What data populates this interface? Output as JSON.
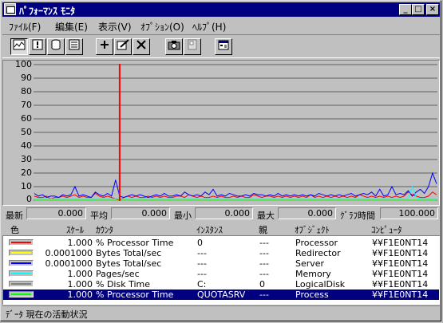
{
  "window": {
    "title": "ﾊﾟﾌｫｰﾏﾝｽ ﾓﾆﾀ"
  },
  "menu": [
    "ﾌｧｲﾙ(F)",
    "編集(E)",
    "表示(V)",
    "ｵﾌﾟｼｮﾝ(O)",
    "ﾍﾙﾌﾟ(H)"
  ],
  "toolbar": {
    "icons": [
      "chart-view-icon",
      "alert-view-icon",
      "log-view-icon",
      "report-view-icon",
      "add-counter-icon",
      "edit-counter-icon",
      "delete-counter-icon",
      "snapshot-icon",
      "bookmark-icon",
      "options-icon"
    ]
  },
  "chart_data": {
    "type": "line",
    "ylim": [
      0,
      100
    ],
    "y_ticks": [
      "100",
      "90",
      "80",
      "70",
      "60",
      "50",
      "40",
      "30",
      "20",
      "10",
      "0"
    ],
    "samples": 100,
    "time_marker_index": 21,
    "grid": "horizontal",
    "series": [
      {
        "color": "#ff0000",
        "values": [
          3,
          2,
          2,
          3,
          1,
          2,
          2,
          3,
          2,
          3,
          4,
          2,
          3,
          2,
          2,
          5,
          3,
          2,
          3,
          2,
          1,
          0,
          2,
          3,
          2,
          3,
          2,
          2,
          3,
          2,
          3,
          2,
          3,
          2,
          2,
          3,
          3,
          2,
          4,
          3,
          2,
          3,
          2,
          2,
          3,
          2,
          3,
          2,
          2,
          3,
          2,
          3,
          2,
          2,
          4,
          3,
          2,
          3,
          3,
          2,
          3,
          2,
          3,
          2,
          3,
          2,
          3,
          2,
          4,
          2,
          3,
          2,
          3,
          2,
          3,
          2,
          3,
          2,
          3,
          2,
          4,
          3,
          2,
          3,
          2,
          3,
          2,
          3,
          2,
          3,
          2,
          3,
          6,
          4,
          3,
          2,
          2,
          3,
          6,
          4
        ]
      },
      {
        "color": "#0000ff",
        "values": [
          5,
          3,
          4,
          2,
          3,
          3,
          2,
          4,
          3,
          4,
          10,
          3,
          4,
          3,
          2,
          6,
          4,
          3,
          5,
          3,
          15,
          3,
          2,
          3,
          4,
          3,
          4,
          3,
          2,
          3,
          4,
          3,
          5,
          3,
          3,
          4,
          3,
          6,
          4,
          3,
          4,
          3,
          6,
          4,
          8,
          3,
          4,
          3,
          5,
          4,
          3,
          3,
          4,
          3,
          5,
          4,
          4,
          3,
          4,
          3,
          5,
          3,
          4,
          3,
          4,
          3,
          4,
          3,
          4,
          3,
          5,
          4,
          3,
          4,
          3,
          4,
          3,
          4,
          5,
          3,
          4,
          5,
          4,
          6,
          3,
          8,
          3,
          4,
          10,
          4,
          5,
          4,
          7,
          3,
          6,
          8,
          5,
          10,
          20,
          12
        ]
      },
      {
        "color": "#00ffff",
        "values": [
          1,
          1,
          1,
          1,
          1,
          1,
          1,
          1,
          1,
          1,
          1,
          1,
          1,
          1,
          1,
          1,
          1,
          1,
          1,
          1,
          1,
          1,
          1,
          1,
          1,
          1,
          1,
          1,
          1,
          1,
          1,
          1,
          1,
          1,
          1,
          1,
          1,
          1,
          1,
          1,
          1,
          1,
          1,
          1,
          1,
          1,
          1,
          1,
          1,
          1,
          1,
          1,
          1,
          1,
          1,
          1,
          1,
          1,
          1,
          1,
          1,
          1,
          1,
          1,
          1,
          1,
          1,
          1,
          1,
          1,
          1,
          1,
          1,
          1,
          1,
          1,
          1,
          1,
          1,
          1,
          1,
          1,
          1,
          1,
          1,
          1,
          1,
          1,
          1,
          1,
          1,
          1,
          1,
          10,
          2,
          1,
          1,
          1,
          1,
          1
        ]
      },
      {
        "color": "#00ff00",
        "values": [
          0,
          0,
          0,
          0,
          0,
          0,
          0,
          0,
          0,
          0,
          0,
          0,
          0,
          0,
          0,
          0,
          0,
          0,
          0,
          0,
          0,
          0,
          0,
          0,
          0,
          0,
          0,
          0,
          0,
          0,
          0,
          0,
          0,
          0,
          0,
          0,
          0,
          0,
          0,
          0,
          0,
          0,
          0,
          0,
          0,
          0,
          0,
          0,
          0,
          0,
          0,
          0,
          0,
          0,
          0,
          0,
          0,
          0,
          0,
          0,
          0,
          0,
          0,
          0,
          0,
          0,
          0,
          0,
          0,
          0,
          0,
          0,
          0,
          0,
          0,
          0,
          0,
          0,
          0,
          0,
          0,
          0,
          0,
          0,
          0,
          0,
          0,
          0,
          0,
          0,
          0,
          0,
          0,
          0,
          0,
          0,
          0,
          0,
          0,
          0
        ]
      }
    ]
  },
  "stats": [
    {
      "label": "最新",
      "value": "0.000"
    },
    {
      "label": "平均",
      "value": "0.000"
    },
    {
      "label": "最小",
      "value": "0.000"
    },
    {
      "label": "最大",
      "value": "0.000"
    },
    {
      "label": "ｸﾞﾗﾌ時間",
      "value": "100.000"
    }
  ],
  "columns": [
    "色",
    "ｽｹｰﾙ",
    "ｶｳﾝﾀ",
    "ｲﾝｽﾀﾝｽ",
    "親",
    "ｵﾌﾞｼﾞｪｸﾄ",
    "ｺﾝﾋﾟｭｰﾀ"
  ],
  "counters": [
    {
      "color": "#ff0000",
      "scale": "1.000",
      "counter": "% Processor Time",
      "instance": "0",
      "parent": "---",
      "object": "Processor",
      "computer": "¥¥F1E0NT14"
    },
    {
      "color": "#ffff00",
      "scale": "0.0001000",
      "counter": "Bytes Total/sec",
      "instance": "---",
      "parent": "---",
      "object": "Redirector",
      "computer": "¥¥F1E0NT14"
    },
    {
      "color": "#0000ff",
      "scale": "0.0001000",
      "counter": "Bytes Total/sec",
      "instance": "---",
      "parent": "---",
      "object": "Server",
      "computer": "¥¥F1E0NT14"
    },
    {
      "color": "#00ffff",
      "scale": "1.000",
      "counter": "Pages/sec",
      "instance": "---",
      "parent": "---",
      "object": "Memory",
      "computer": "¥¥F1E0NT14"
    },
    {
      "color": "#808080",
      "scale": "1.000",
      "counter": "% Disk Time",
      "instance": "C:",
      "parent": "0",
      "object": "LogicalDisk",
      "computer": "¥¥F1E0NT14"
    },
    {
      "color": "#00ff00",
      "scale": "1.000",
      "counter": "% Processor Time",
      "instance": "QUOTASRV",
      "parent": "---",
      "object": "Process",
      "computer": "¥¥F1E0NT14",
      "selected": true
    }
  ],
  "status": "ﾃﾞｰﾀ 現在の活動状況"
}
